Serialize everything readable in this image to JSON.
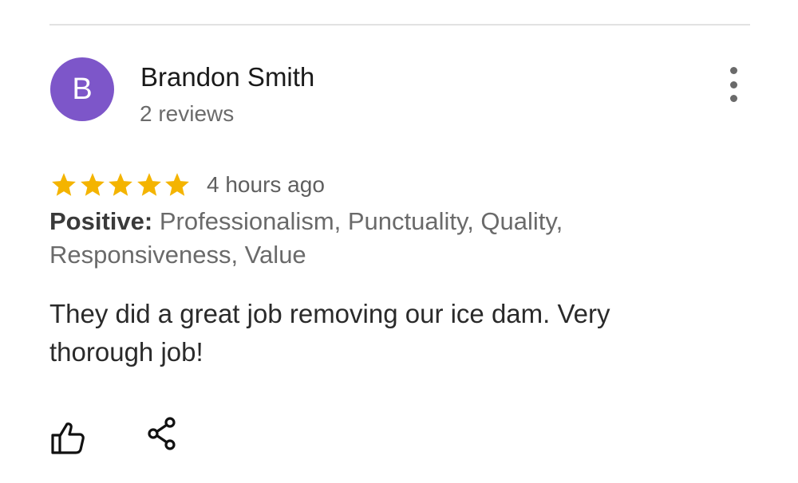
{
  "review": {
    "avatar_initial": "B",
    "author_name": "Brandon Smith",
    "review_count": "2 reviews",
    "rating": 5,
    "rating_max": 5,
    "time_ago": "4 hours ago",
    "attributes_label": "Positive:",
    "attributes_text": "Professionalism, Punctuality, Quality, Responsiveness, Value",
    "text": "They did a great job removing our ice dam.  Very thorough job!"
  },
  "icons": {
    "more": "more-vertical-icon",
    "star": "star-icon",
    "like": "thumbs-up-icon",
    "share": "share-icon"
  },
  "colors": {
    "avatar_bg": "#7d56c9",
    "star": "#f4b400"
  }
}
